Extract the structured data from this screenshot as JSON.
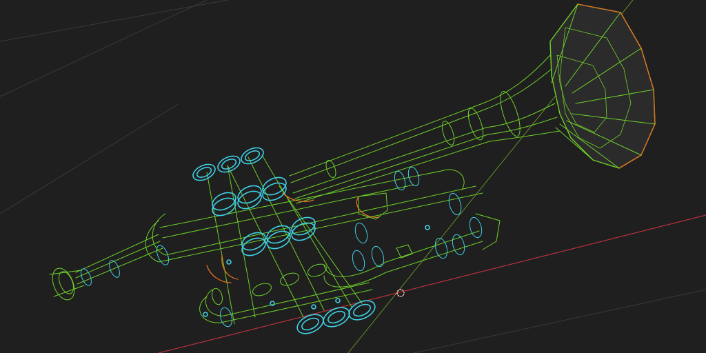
{
  "viewport": {
    "background": "#1f1f1f",
    "wire_color": "#6fd12a",
    "wire_dark": "#3f8f1c",
    "selected_color": "#3fd0e6",
    "edge_highlight": "#e07020",
    "x_axis_color": "#b8323c",
    "y_axis_color": "#7cbf2e",
    "face_fill": "#2b2b2b"
  },
  "icons": {
    "cursor": "3d-cursor-icon"
  }
}
